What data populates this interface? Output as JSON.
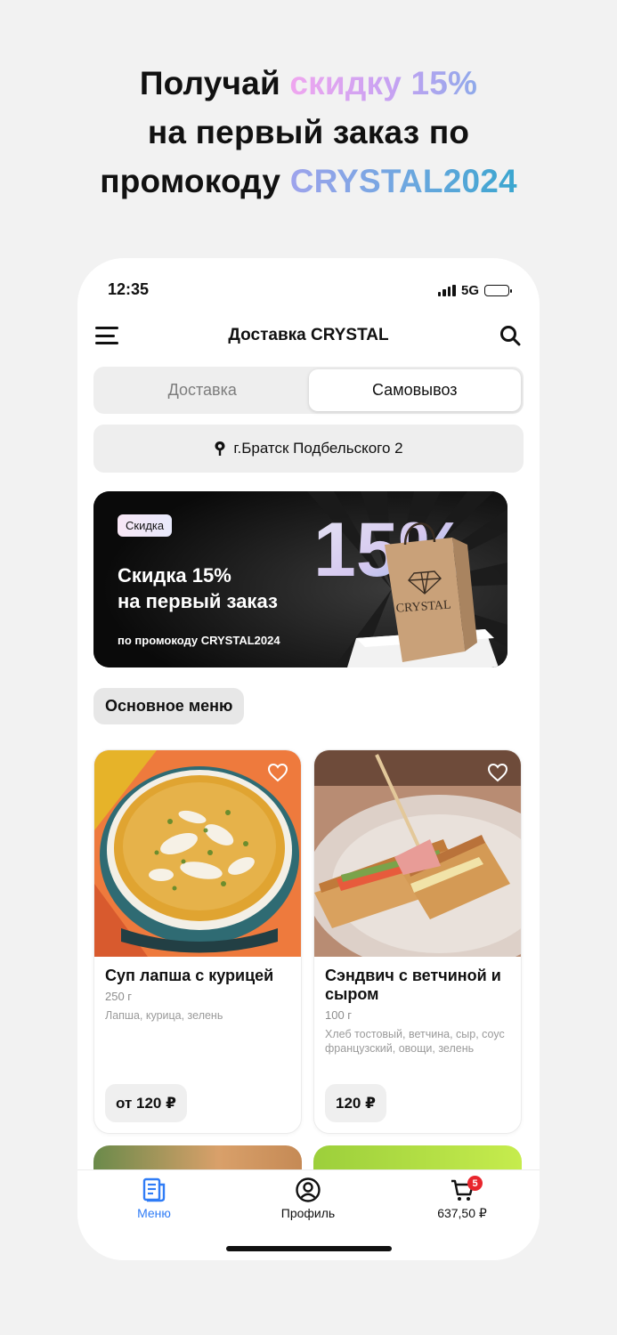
{
  "headline": {
    "line1_prefix": "Получай ",
    "line1_highlight": "скидку 15%",
    "line2": "на первый заказ по",
    "line3_prefix": "промокоду ",
    "line3_highlight": "CRYSTAL2024"
  },
  "status_bar": {
    "time": "12:35",
    "network": "5G"
  },
  "app_bar": {
    "title": "Доставка CRYSTAL"
  },
  "delivery_mode": {
    "options": [
      {
        "label": "Доставка",
        "selected": false
      },
      {
        "label": "Самовывоз",
        "selected": true
      }
    ]
  },
  "address": {
    "text": "г.Братск Подбельского 2"
  },
  "promo_banner": {
    "chip": "Скидка",
    "heading": "Скидка 15%\nна первый заказ",
    "heading_line1": "Скидка 15%",
    "heading_line2": "на первый заказ",
    "sub": "по промокоду CRYSTAL2024",
    "big_number": "15%",
    "bag_brand": "CRYSTAL"
  },
  "category": {
    "label": "Основное меню"
  },
  "products": [
    {
      "name": "Суп лапша с курицей",
      "weight": "250 г",
      "description": "Лапша, курица, зелень",
      "price": "от 120 ₽"
    },
    {
      "name": "Сэндвич с ветчиной и сыром",
      "weight": "100 г",
      "description": "Хлеб тостовый, ветчина, сыр, соус французский, овощи, зелень",
      "price": "120 ₽"
    }
  ],
  "tab_bar": {
    "tabs": [
      {
        "label": "Меню",
        "icon": "menu-doc-icon",
        "active": true
      },
      {
        "label": "Профиль",
        "icon": "profile-icon",
        "active": false
      },
      {
        "label": "637,50 ₽",
        "icon": "cart-icon",
        "active": false,
        "badge": "5"
      }
    ]
  },
  "colors": {
    "accent": "#2f7cf6",
    "badge": "#e8262d"
  }
}
